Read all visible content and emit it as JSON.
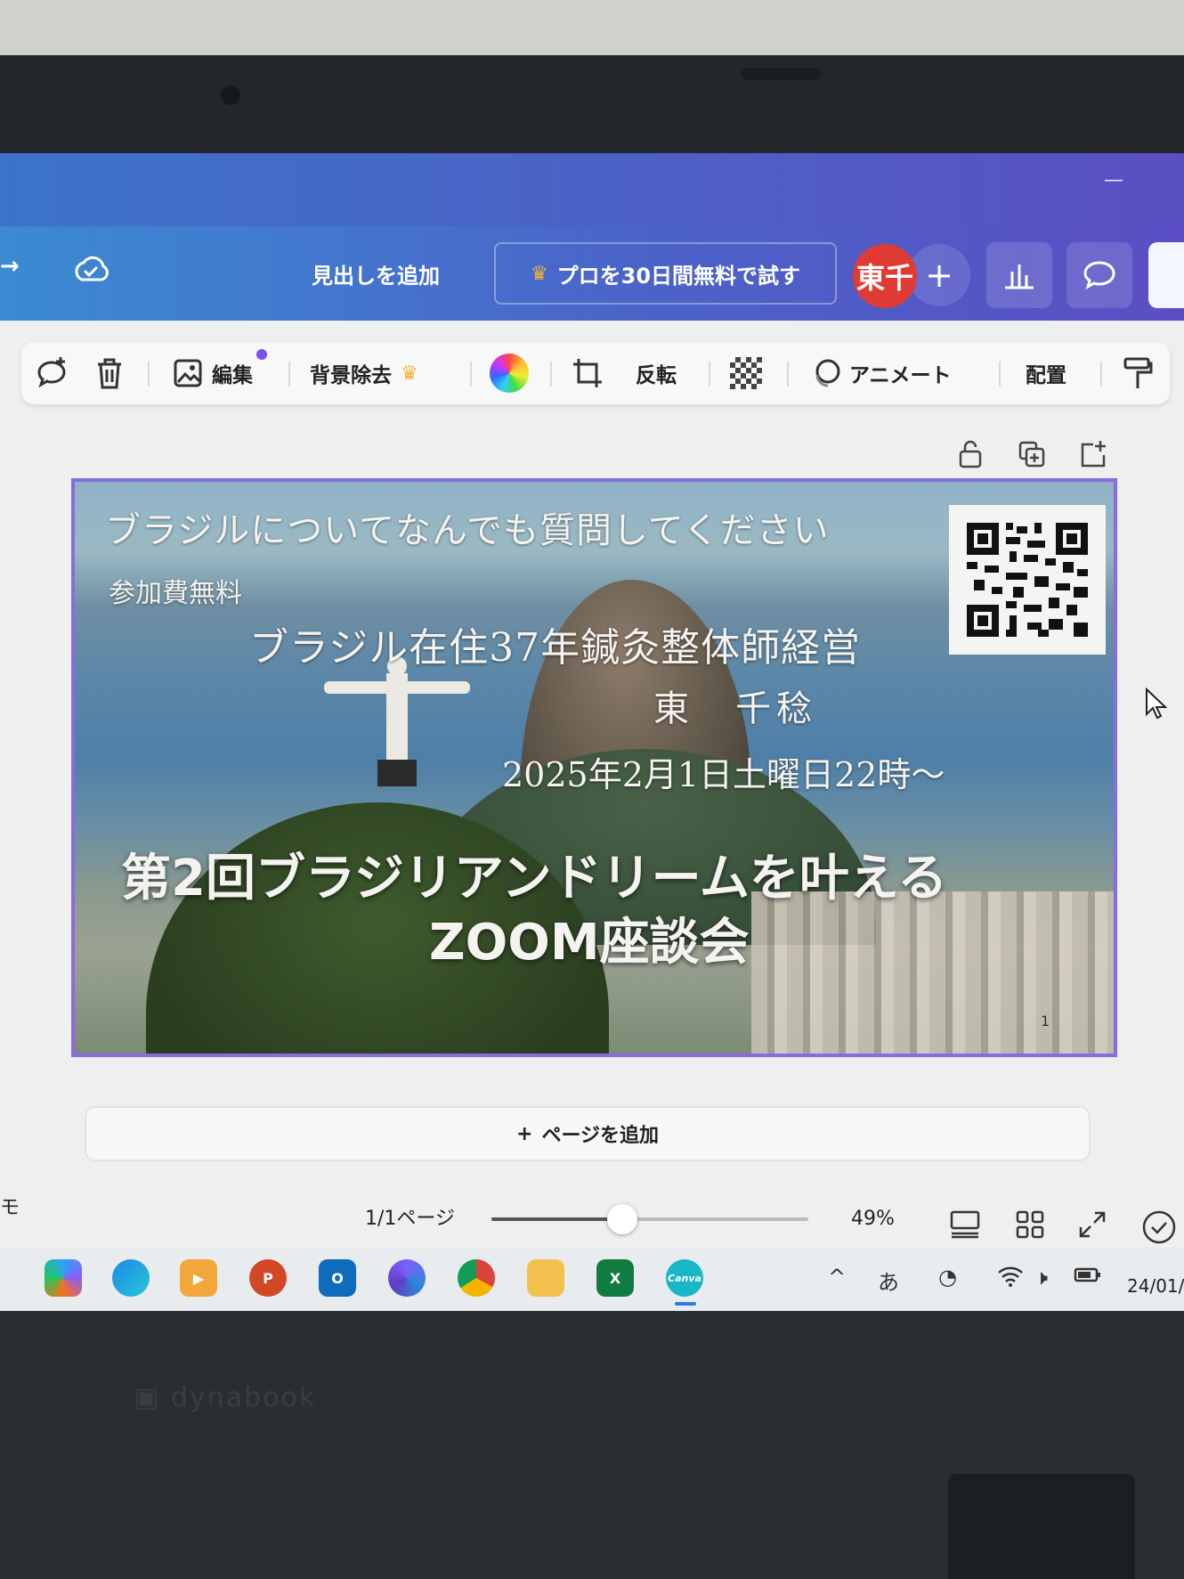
{
  "toolbar": {
    "add_heading": "見出しを追加",
    "pro_trial": "プロを30日間無料で試す",
    "avatar_initials": "東千",
    "plus": "+"
  },
  "context_toolbar": {
    "edit": "編集",
    "remove_bg": "背景除去",
    "flip": "反転",
    "animate": "アニメート",
    "arrange": "配置"
  },
  "slide": {
    "question_line": "ブラジルについてなんでも質問してください",
    "free_fee": "参加費無料",
    "presenter_desc": "ブラジル在住37年鍼灸整体師経営",
    "presenter_name": "東　千稔",
    "datetime": "2025年2月1日土曜日22時～",
    "headline_1": "第2回ブラジリアンドリームを叶える",
    "headline_2": "ZOOM座談会",
    "page_number": "1"
  },
  "add_page": {
    "plus": "+",
    "label": "ページを追加"
  },
  "status_bar": {
    "notes_fragment": "モ",
    "page_indicator": "1/1ページ",
    "zoom": "49%",
    "zoom_value": 49
  },
  "taskbar": {
    "ime": "あ",
    "date_fragment": "24/01/"
  },
  "colors": {
    "accent": "#7b4ff0",
    "avatar": "#e03b32",
    "crown": "#f4b23a",
    "selection": "#8a6be0"
  }
}
